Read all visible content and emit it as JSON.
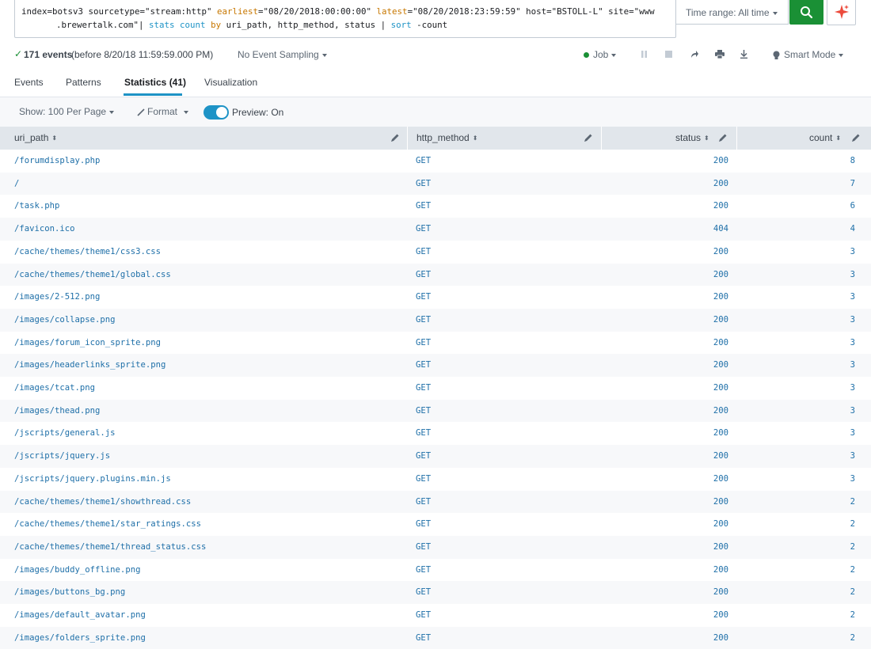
{
  "search": {
    "query_line1": [
      {
        "t": "index=botsv3 sourcetype=\"stream:http\" ",
        "c": "q-key"
      },
      {
        "t": "earliest",
        "c": "q-org"
      },
      {
        "t": "=\"08/20/2018:00:00:00\" ",
        "c": "q-str"
      },
      {
        "t": "latest",
        "c": "q-org"
      },
      {
        "t": "=\"08/20/2018:23:59:59\" host=\"BSTOLL-L\" site=\"www",
        "c": "q-str"
      }
    ],
    "query_line2": [
      {
        "t": ".brewertalk.com\"| ",
        "c": "q-str"
      },
      {
        "t": "stats",
        "c": "q-blue"
      },
      {
        "t": " ",
        "c": "q-str"
      },
      {
        "t": "count",
        "c": "q-blue"
      },
      {
        "t": " ",
        "c": "q-str"
      },
      {
        "t": "by",
        "c": "q-org"
      },
      {
        "t": " uri_path, http_method, status | ",
        "c": "q-str"
      },
      {
        "t": "sort",
        "c": "q-blue"
      },
      {
        "t": " -count",
        "c": "q-str"
      }
    ],
    "time_range_label": "Time range: All time"
  },
  "status": {
    "events_count": "171 events",
    "events_suffix": "(before 8/20/18 11:59:59.000 PM)",
    "sampling": "No Event Sampling",
    "job": "Job",
    "mode": "Smart Mode"
  },
  "tabs": [
    {
      "label": "Events"
    },
    {
      "label": "Patterns"
    },
    {
      "label": "Statistics (41)"
    },
    {
      "label": "Visualization"
    }
  ],
  "options": {
    "per_page": "Show: 100 Per Page",
    "format": "Format",
    "preview": "Preview: On"
  },
  "table": {
    "columns": [
      "uri_path",
      "http_method",
      "status",
      "count"
    ],
    "rows": [
      [
        "/forumdisplay.php",
        "GET",
        "200",
        "8"
      ],
      [
        "/",
        "GET",
        "200",
        "7"
      ],
      [
        "/task.php",
        "GET",
        "200",
        "6"
      ],
      [
        "/favicon.ico",
        "GET",
        "404",
        "4"
      ],
      [
        "/cache/themes/theme1/css3.css",
        "GET",
        "200",
        "3"
      ],
      [
        "/cache/themes/theme1/global.css",
        "GET",
        "200",
        "3"
      ],
      [
        "/images/2-512.png",
        "GET",
        "200",
        "3"
      ],
      [
        "/images/collapse.png",
        "GET",
        "200",
        "3"
      ],
      [
        "/images/forum_icon_sprite.png",
        "GET",
        "200",
        "3"
      ],
      [
        "/images/headerlinks_sprite.png",
        "GET",
        "200",
        "3"
      ],
      [
        "/images/tcat.png",
        "GET",
        "200",
        "3"
      ],
      [
        "/images/thead.png",
        "GET",
        "200",
        "3"
      ],
      [
        "/jscripts/general.js",
        "GET",
        "200",
        "3"
      ],
      [
        "/jscripts/jquery.js",
        "GET",
        "200",
        "3"
      ],
      [
        "/jscripts/jquery.plugins.min.js",
        "GET",
        "200",
        "3"
      ],
      [
        "/cache/themes/theme1/showthread.css",
        "GET",
        "200",
        "2"
      ],
      [
        "/cache/themes/theme1/star_ratings.css",
        "GET",
        "200",
        "2"
      ],
      [
        "/cache/themes/theme1/thread_status.css",
        "GET",
        "200",
        "2"
      ],
      [
        "/images/buddy_offline.png",
        "GET",
        "200",
        "2"
      ],
      [
        "/images/buttons_bg.png",
        "GET",
        "200",
        "2"
      ],
      [
        "/images/default_avatar.png",
        "GET",
        "200",
        "2"
      ],
      [
        "/images/folders_sprite.png",
        "GET",
        "200",
        "2"
      ]
    ]
  },
  "colors": {
    "accent": "#1e93c6",
    "search_button": "#1a9035",
    "link": "#1e6fa8",
    "header_bg": "#e1e6eb"
  }
}
